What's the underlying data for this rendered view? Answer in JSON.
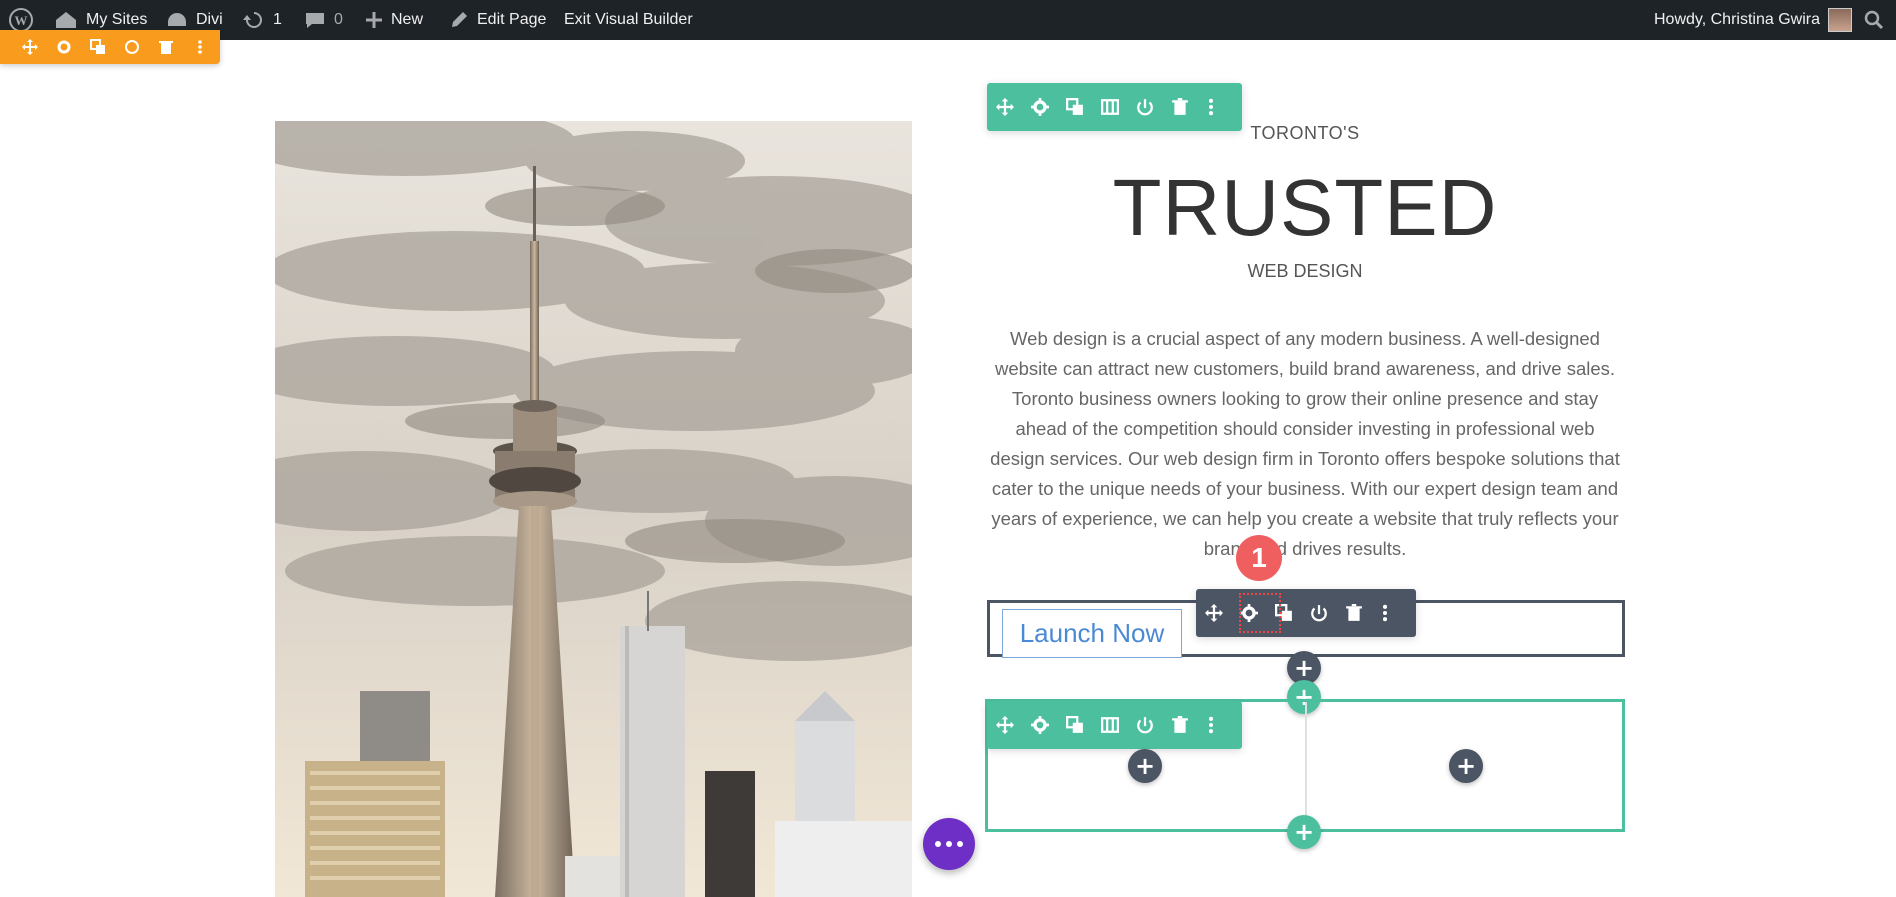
{
  "admin_bar": {
    "my_sites": "My Sites",
    "site_name": "Divi",
    "updates_count": "1",
    "comments_count": "0",
    "new_label": "New",
    "edit_page_label": "Edit Page",
    "exit_builder_label": "Exit Visual Builder",
    "greeting": "Howdy, Christina Gwira"
  },
  "content": {
    "eyebrow": "TORONTO'S",
    "headline": "TRUSTED",
    "subhead": "WEB DESIGN",
    "body": "Web design is a crucial aspect of any modern business. A well-designed website can attract new customers, build brand awareness, and drive sales. Toronto business owners looking to grow their online presence and stay ahead of the competition should consider investing in professional web design services. Our web design firm in Toronto offers bespoke solutions that cater to the unique needs of your business. With our expert design team and years of experience, we can help you create a website that truly reflects your brand and drives results.",
    "button_label": "Launch Now"
  },
  "annotation": {
    "step_badge": "1"
  },
  "colors": {
    "row_toolbar": "#4cbf9f",
    "module_toolbar": "#4b5563",
    "section_toolbar": "#f99b1c",
    "step_badge": "#ef5f5f",
    "page_settings_button": "#6d2fc6"
  },
  "icons": {
    "toolbar": [
      "move-icon",
      "settings-icon",
      "duplicate-icon",
      "columns-icon",
      "save-icon",
      "delete-icon",
      "more-icon"
    ]
  }
}
